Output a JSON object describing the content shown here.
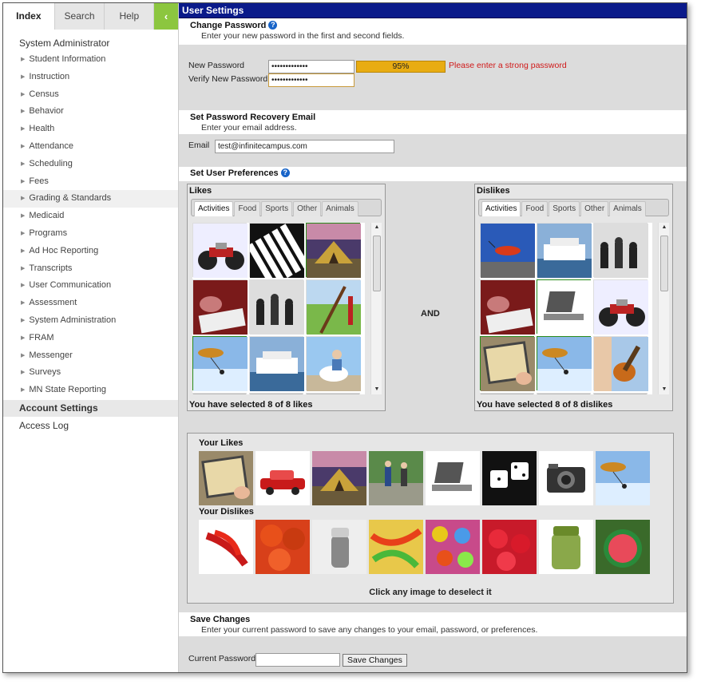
{
  "nav": {
    "tabs": [
      "Index",
      "Search",
      "Help"
    ],
    "collapse": "‹",
    "header": "System Administrator",
    "items": [
      "Student Information",
      "Instruction",
      "Census",
      "Behavior",
      "Health",
      "Attendance",
      "Scheduling",
      "Fees",
      "Grading & Standards",
      "Medicaid",
      "Programs",
      "Ad Hoc Reporting",
      "Transcripts",
      "User Communication",
      "Assessment",
      "System Administration",
      "FRAM",
      "Messenger",
      "Surveys",
      "MN State Reporting"
    ],
    "account": "Account Settings",
    "log": "Access Log"
  },
  "main": {
    "title": "User Settings",
    "change_pw": {
      "title": "Change Password",
      "sub": "Enter your new password in the first and second fields.",
      "new_label": "New Password",
      "verify_label": "Verify New Password",
      "new_value": "•••••••••••••",
      "verify_value": "•••••••••••••",
      "strength": "95%",
      "warning": "Please enter a strong password"
    },
    "recovery": {
      "title": "Set Password Recovery Email",
      "sub": "Enter your email address.",
      "email_label": "Email",
      "email_value": "test@infinitecampus.com"
    },
    "prefs": {
      "title": "Set User Preferences",
      "likes_title": "Likes",
      "dislikes_title": "Dislikes",
      "tabs": [
        "Activities",
        "Food",
        "Sports",
        "Other",
        "Animals"
      ],
      "and": "AND",
      "likes_foot": "You have selected 8 of 8 likes",
      "dislikes_foot": "You have selected 8 of 8 dislikes",
      "your_likes": "Your Likes",
      "your_dislikes": "Your Dislikes",
      "deselect": "Click any image to deselect it"
    },
    "save": {
      "title": "Save Changes",
      "sub": "Enter your current password to save any changes to your email, password, or preferences.",
      "label": "Current Password",
      "button": "Save Changes"
    }
  },
  "images": {
    "likes_grid": [
      "motorcycle",
      "piano-keys",
      "tent",
      "reading-book",
      "chess-pieces",
      "archery",
      "parachute",
      "cruise-ship",
      "horse-rider"
    ],
    "dislikes_grid": [
      "fishing-fly",
      "cruise-ship",
      "chess-pieces",
      "reading-book",
      "laptop",
      "motorcycle",
      "tablet",
      "parachute",
      "guitar"
    ],
    "your_likes": [
      "tablet",
      "classic-car",
      "tent",
      "runners",
      "laptop",
      "dice",
      "camera",
      "parachute"
    ],
    "your_dislikes": [
      "chili-peppers",
      "tomatoes",
      "pepper-shaker",
      "gummy-worms",
      "candies",
      "strawberries",
      "pickle-jar",
      "watermelon"
    ]
  },
  "colors": {
    "titlebar": "#0a1a8a",
    "accent_green": "#8cc63f",
    "meter": "#e8ac12",
    "warning": "#d01818"
  }
}
